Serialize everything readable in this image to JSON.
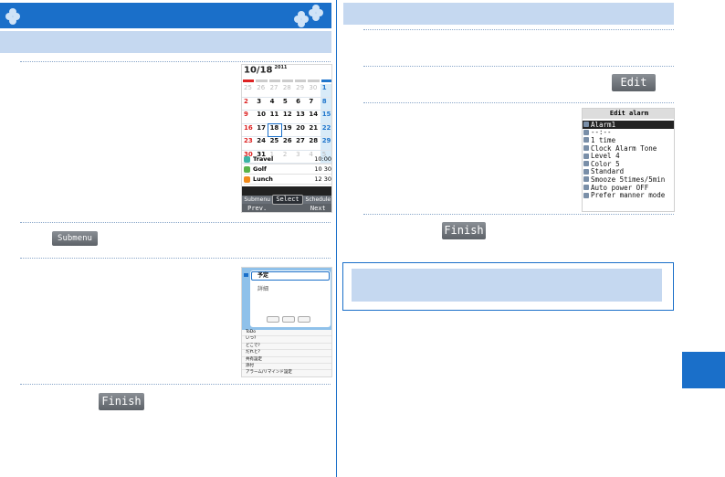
{
  "left_column": {
    "submenu_label": "Submenu",
    "finish_label": "Finish"
  },
  "right_column": {
    "edit_label": "Edit",
    "finish_label": "Finish"
  },
  "calendar_screen": {
    "date_title": "10/18",
    "year": "2011",
    "weeks": [
      [
        "25",
        "26",
        "27",
        "28",
        "29",
        "30",
        "1"
      ],
      [
        "2",
        "3",
        "4",
        "5",
        "6",
        "7",
        "8"
      ],
      [
        "9",
        "10",
        "11",
        "12",
        "13",
        "14",
        "15"
      ],
      [
        "16",
        "17",
        "18",
        "19",
        "20",
        "21",
        "22"
      ],
      [
        "23",
        "24",
        "25",
        "26",
        "27",
        "28",
        "29"
      ],
      [
        "30",
        "31",
        "1",
        "2",
        "3",
        "4",
        "5"
      ]
    ],
    "events": [
      {
        "name": "Travel",
        "time": "10:00",
        "color": "#3bb4a4"
      },
      {
        "name": "Golf",
        "time": "10 30",
        "color": "#5ab34a"
      },
      {
        "name": "Lunch",
        "time": "12 30",
        "color": "#f08a1c"
      }
    ],
    "softkeys_top": [
      "Submenu",
      "",
      "Schedule"
    ],
    "select_label": "Select",
    "softkeys_bottom": [
      "Prev.",
      "",
      "Next"
    ]
  },
  "schedule_screen": {
    "title": "予定",
    "subtitle": "詳細",
    "list": [
      "ToDo",
      "いつ?",
      "どこで?",
      "だれと?",
      "共有設定",
      "添付",
      "アラーム/リマインド設定"
    ]
  },
  "alarm_screen": {
    "title": "Edit alarm",
    "items": [
      "Alarm1",
      "--:--",
      "1 time",
      "Clock Alarm Tone",
      "Level 4",
      "Color 5",
      "Standard",
      "Smooze 5times/5min",
      "Auto power OFF",
      "Prefer manner mode"
    ]
  },
  "colors": {
    "brand_blue": "#1a6fc9",
    "light_blue": "#c5d8f0"
  }
}
